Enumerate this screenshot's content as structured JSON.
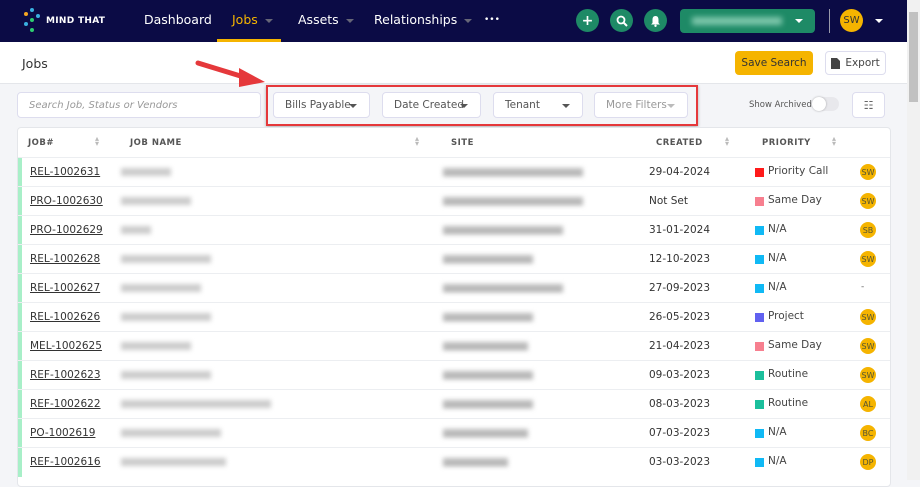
{
  "nav": {
    "brand": "MIND THAT",
    "items": [
      {
        "label": "Dashboard"
      },
      {
        "label": "Jobs"
      },
      {
        "label": "Assets"
      },
      {
        "label": "Relationships"
      }
    ],
    "more": "•••",
    "user_initials": "SW"
  },
  "page": {
    "title": "Jobs",
    "save_search": "Save Search",
    "export": "Export"
  },
  "filters": {
    "search_placeholder": "Search Job, Status or Vendors",
    "bills_payable": "Bills Payable",
    "date_created": "Date Created",
    "tenant": "Tenant",
    "more_filters": "More Filters",
    "show_archived": "Show Archived"
  },
  "table": {
    "headers": {
      "job": "JOB#",
      "name": "JOB NAME",
      "site": "SITE",
      "created": "CREATED",
      "priority": "PRIORITY"
    },
    "rows": [
      {
        "job": "REL-1002631",
        "created": "29-04-2024",
        "priority": "Priority Call",
        "color": "#ff1a1a",
        "assignee": "SW"
      },
      {
        "job": "PRO-1002630",
        "created": "Not Set",
        "priority": "Same Day",
        "color": "#f77f8f",
        "assignee": "SW"
      },
      {
        "job": "PRO-1002629",
        "created": "31-01-2024",
        "priority": "N/A",
        "color": "#10b9f5",
        "assignee": "SB"
      },
      {
        "job": "REL-1002628",
        "created": "12-10-2023",
        "priority": "N/A",
        "color": "#10b9f5",
        "assignee": "SW"
      },
      {
        "job": "REL-1002627",
        "created": "27-09-2023",
        "priority": "N/A",
        "color": "#10b9f5",
        "assignee": "-"
      },
      {
        "job": "REL-1002626",
        "created": "26-05-2023",
        "priority": "Project",
        "color": "#6161f0",
        "assignee": "SW"
      },
      {
        "job": "MEL-1002625",
        "created": "21-04-2023",
        "priority": "Same Day",
        "color": "#f77f8f",
        "assignee": "SW"
      },
      {
        "job": "REF-1002623",
        "created": "09-03-2023",
        "priority": "Routine",
        "color": "#1bbf9c",
        "assignee": "SW"
      },
      {
        "job": "REF-1002622",
        "created": "08-03-2023",
        "priority": "Routine",
        "color": "#1bbf9c",
        "assignee": "AL"
      },
      {
        "job": "PO-1002619",
        "created": "07-03-2023",
        "priority": "N/A",
        "color": "#10b9f5",
        "assignee": "BC"
      },
      {
        "job": "REF-1002616",
        "created": "03-03-2023",
        "priority": "N/A",
        "color": "#10b9f5",
        "assignee": "DP"
      }
    ]
  }
}
